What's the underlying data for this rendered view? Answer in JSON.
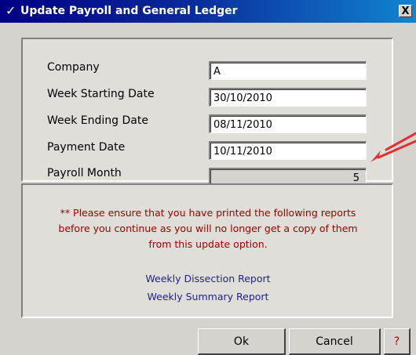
{
  "window": {
    "title": "Update Payroll and General Ledger",
    "title_icon": "✓",
    "close_label": "X"
  },
  "form": {
    "company_label": "Company",
    "company_value": "A",
    "week_start_label": "Week Starting Date",
    "week_start_value": "30/10/2010",
    "week_end_label": "Week Ending Date",
    "week_end_value": "08/11/2010",
    "payment_label": "Payment Date",
    "payment_value": "10/11/2010",
    "payroll_month_label": "Payroll Month",
    "payroll_month_value": "5"
  },
  "notice": {
    "line1": "** Please ensure that you have printed the following reports",
    "line2": "before you continue as you will no longer get a copy of them",
    "line3": "from this update option.",
    "report1": "Weekly Dissection Report",
    "report2": "Weekly Summary Report"
  },
  "buttons": {
    "ok": "Ok",
    "cancel": "Cancel",
    "help": "?"
  },
  "colors": {
    "title_gradient_start": "#000084",
    "title_gradient_end": "#1084d0",
    "warning_text": "#a00000",
    "link_text": "#1f1f8f",
    "annotation_arrow": "#e03030"
  }
}
